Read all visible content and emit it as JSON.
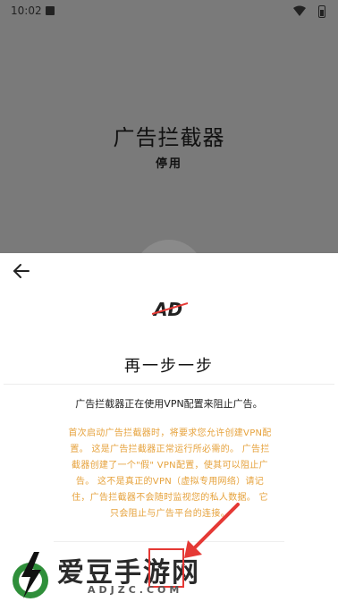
{
  "status_bar": {
    "time": "10:02"
  },
  "background": {
    "title": "广告拦截器",
    "status": "停用"
  },
  "sheet": {
    "logo_text": "AD",
    "title": "再一步一步",
    "subtitle": "广告拦截器正在使用VPN配置来阻止广告。",
    "notice": "首次启动广告拦截器时，将要求您允许创建VPN配置。 这是广告拦截器正常运行所必需的。 广告拦截器创建了一个\"假\" VPN配置，使其可以阻止广告。 这不是真正的VPN（虚拟专用网络）请记住，广告拦截器不会随时监视您的私人数据。 它只会阻止与广告平台的连接。",
    "accent_color": "#e6a23c"
  },
  "watermark": {
    "text": "爱豆手游网",
    "url": "ADJZC.COM"
  }
}
